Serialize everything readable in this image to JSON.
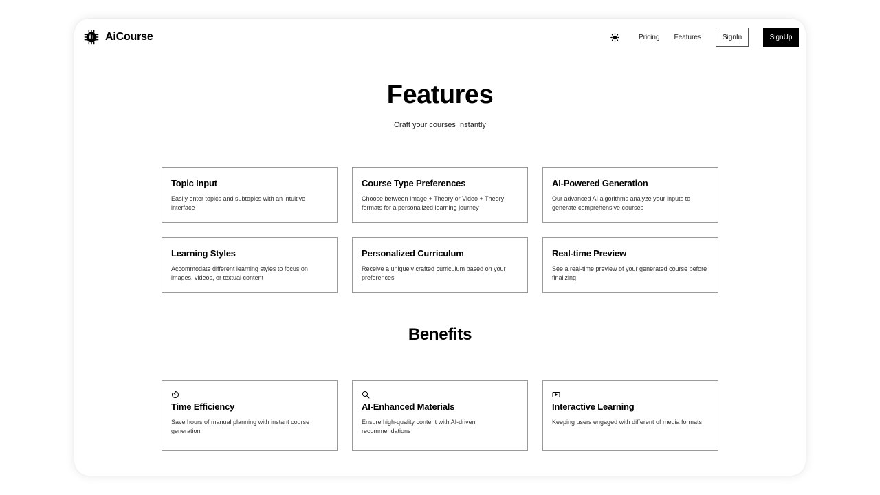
{
  "header": {
    "brand": "AiCourse",
    "nav": {
      "pricing": "Pricing",
      "features": "Features",
      "signin": "SignIn",
      "signup": "SignUp"
    }
  },
  "features_section": {
    "title": "Features",
    "subtitle": "Craft your courses Instantly",
    "cards": [
      {
        "title": "Topic Input",
        "description": "Easily enter topics and subtopics with an intuitive interface"
      },
      {
        "title": "Course Type Preferences",
        "description": "Choose between Image + Theory or Video + Theory formats for a personalized learning journey"
      },
      {
        "title": "AI-Powered Generation",
        "description": "Our advanced AI algorithms analyze your inputs to generate comprehensive courses"
      },
      {
        "title": "Learning Styles",
        "description": "Accommodate different learning styles to focus on images, videos, or textual content"
      },
      {
        "title": "Personalized Curriculum",
        "description": "Receive a uniquely crafted curriculum based on your preferences"
      },
      {
        "title": "Real-time Preview",
        "description": "See a real-time preview of your generated course before finalizing"
      }
    ]
  },
  "benefits_section": {
    "title": "Benefits",
    "cards": [
      {
        "icon": "timer-icon",
        "title": "Time Efficiency",
        "description": "Save hours of manual planning with instant course generation"
      },
      {
        "icon": "search-icon",
        "title": "AI-Enhanced Materials",
        "description": "Ensure high-quality content with AI-driven recommendations"
      },
      {
        "icon": "video-icon",
        "title": "Interactive Learning",
        "description": "Keeping users engaged with different of media formats"
      }
    ]
  },
  "icons": {
    "logo": "ai-chip-logo-icon",
    "theme_toggle": "sun-icon"
  },
  "colors": {
    "accent": "#000000",
    "background": "#ffffff",
    "card_border": "#9a9a9a"
  }
}
